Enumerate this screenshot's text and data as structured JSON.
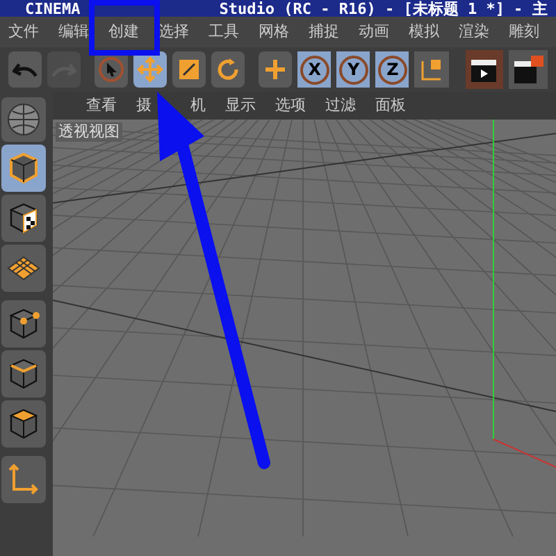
{
  "window": {
    "title_start": "CINEMA",
    "title_end": "Studio (RC - R16) - [未标题 1 *] - 主"
  },
  "menu": [
    "文件",
    "编辑",
    "创建",
    "选择",
    "工具",
    "网格",
    "捕捉",
    "动画",
    "模拟",
    "渲染",
    "雕刻"
  ],
  "toolbar": [
    {
      "kind": "undo",
      "selected": false,
      "disabled": false
    },
    {
      "kind": "redo",
      "selected": false,
      "disabled": true
    },
    {
      "kind": "select",
      "selected": false,
      "disabled": false
    },
    {
      "kind": "move",
      "selected": true,
      "disabled": false
    },
    {
      "kind": "scale",
      "selected": false,
      "disabled": false
    },
    {
      "kind": "rotate",
      "selected": false,
      "disabled": false
    },
    {
      "kind": "add",
      "selected": false,
      "disabled": false
    }
  ],
  "axes": [
    {
      "label": "X",
      "selected": true
    },
    {
      "label": "Y",
      "selected": true
    },
    {
      "label": "Z",
      "selected": true
    }
  ],
  "viewport": {
    "menu": [
      "查看",
      "摄",
      "机",
      "显示",
      "选项",
      "过滤",
      "面板"
    ],
    "label": "透视视图"
  },
  "left_tools": [
    {
      "kind": "cube",
      "selected": true
    },
    {
      "kind": "texture",
      "selected": false
    },
    {
      "kind": "plane",
      "selected": false
    },
    {
      "kind": "points",
      "selected": false
    },
    {
      "kind": "edges",
      "selected": false
    },
    {
      "kind": "polygons",
      "selected": false
    },
    {
      "kind": "axis",
      "selected": false
    }
  ]
}
